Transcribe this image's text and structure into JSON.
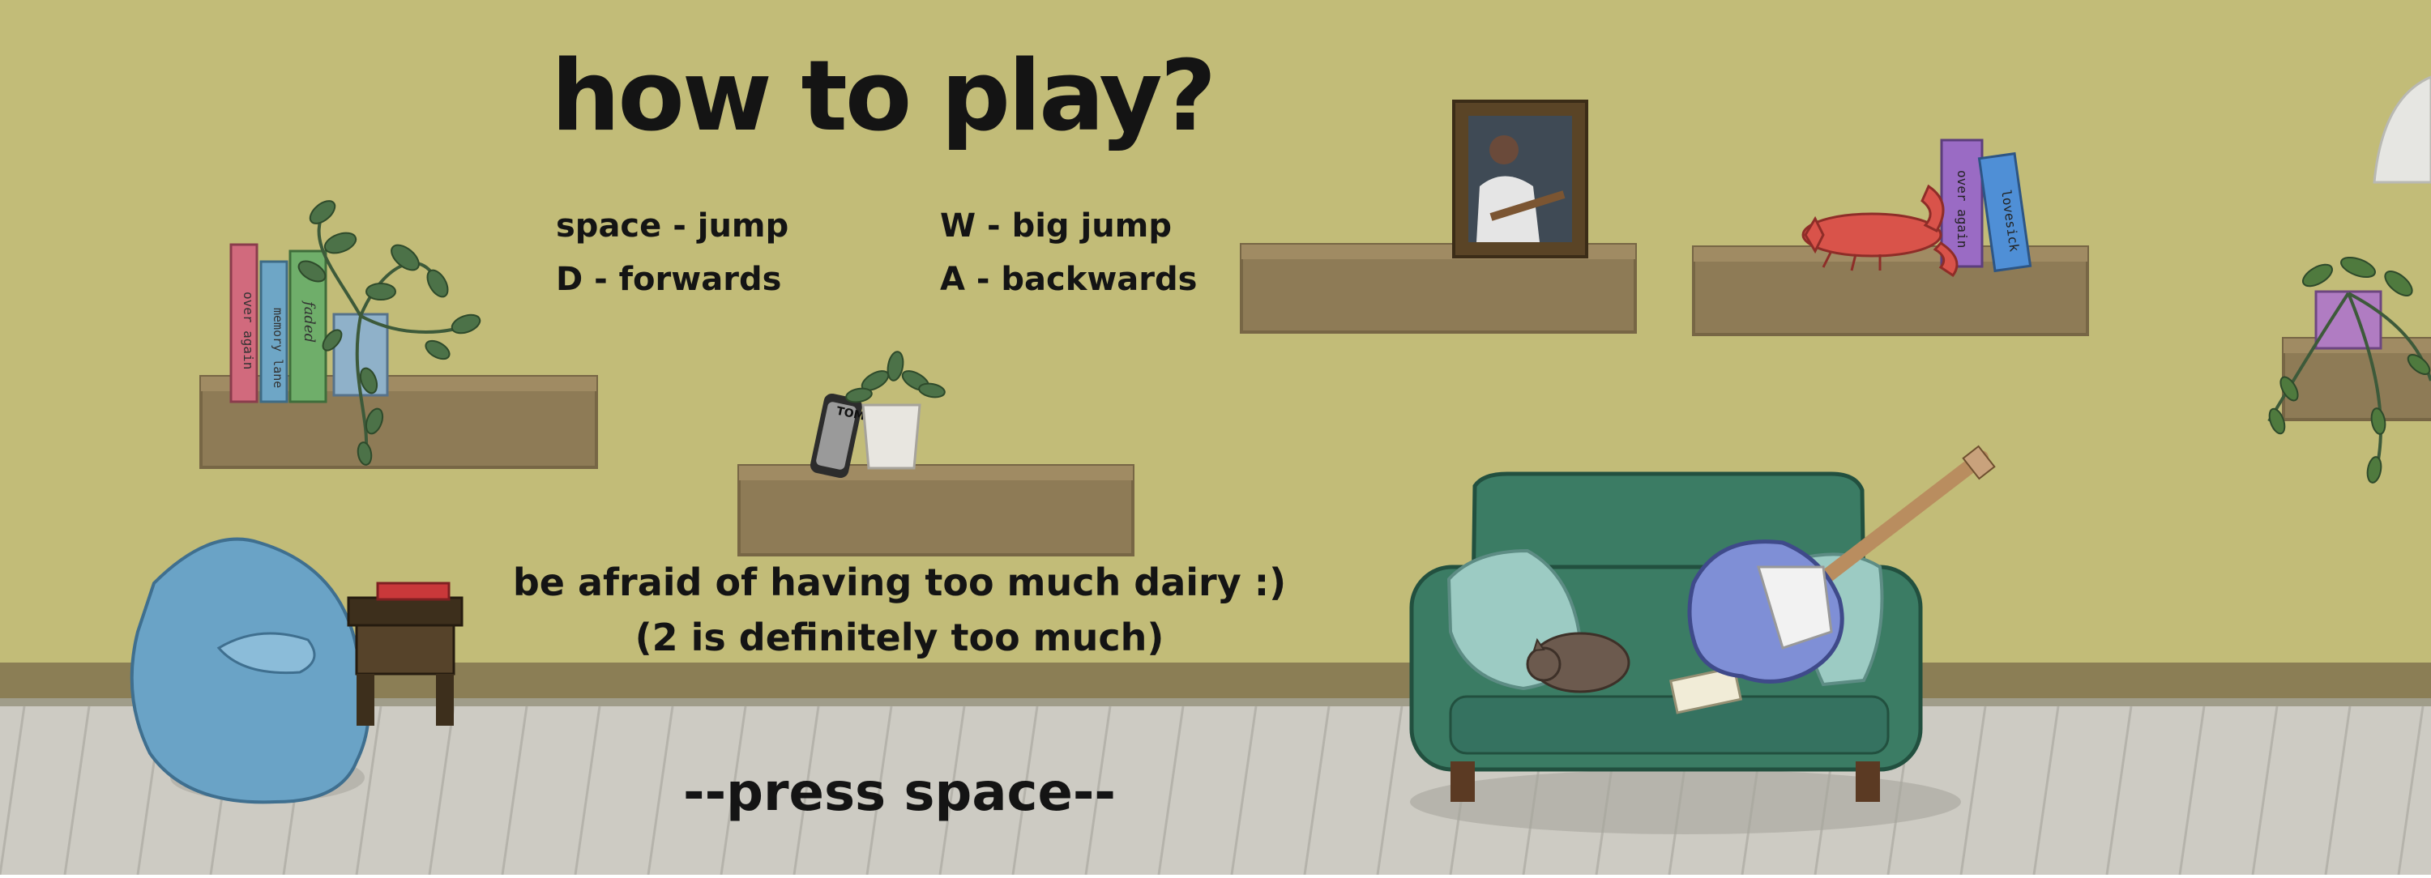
{
  "title": "how to play?",
  "controls": {
    "jump": "space - jump",
    "forwards": "D - forwards",
    "big_jump": "W - big jump",
    "backwards": "A - backwards"
  },
  "warning": {
    "line1": "be afraid of having too much dairy :)",
    "line2": "(2 is definitely too much)"
  },
  "prompt": "--press space--",
  "book_spines": {
    "left_shelf_1": "over again",
    "left_shelf_2": "memory lane",
    "left_shelf_3": "faded",
    "right_shelf_1": "over again",
    "right_shelf_2": "lovesick"
  },
  "phone_label": "TOMU",
  "colors": {
    "wall": "#c2bc78",
    "floor": "#cdcbc3",
    "shelf": "#8e7b56",
    "sofa": "#3b7c64",
    "beanbag": "#6aa3c6",
    "guitar": "#7f8fd6",
    "lobster": "#d9534a",
    "text": "#141414"
  },
  "icons": [
    "beanbag",
    "side-table",
    "book",
    "potted-plant",
    "photo-frame",
    "lobster",
    "phone",
    "sofa",
    "guitar",
    "cat",
    "cushion",
    "lamp"
  ]
}
